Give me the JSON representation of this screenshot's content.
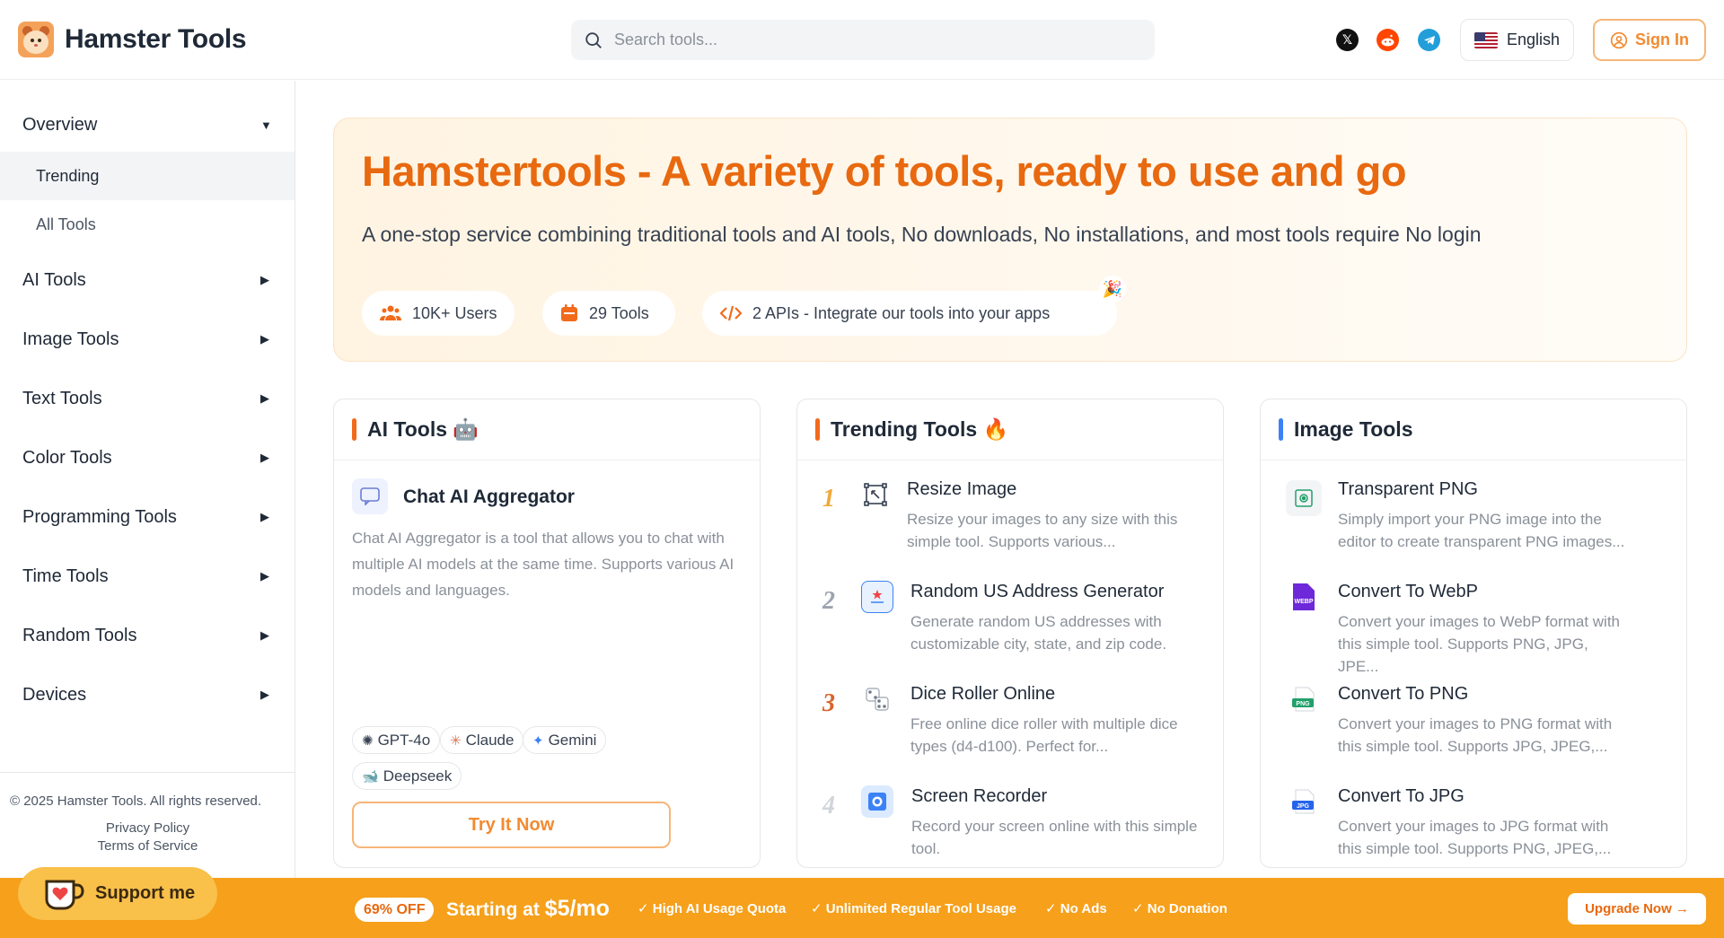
{
  "header": {
    "brand": "Hamster Tools",
    "search_placeholder": "Search tools...",
    "language": "English",
    "signin": "Sign In"
  },
  "sidebar": {
    "overview": "Overview",
    "sub_items": [
      "Trending",
      "All Tools"
    ],
    "items": [
      "AI Tools",
      "Image Tools",
      "Text Tools",
      "Color Tools",
      "Programming Tools",
      "Time Tools",
      "Random Tools",
      "Devices"
    ],
    "copyright": "© 2025 Hamster Tools. All rights reserved.",
    "privacy": "Privacy Policy",
    "terms": "Terms of Service",
    "support": "Support me"
  },
  "hero": {
    "title": "Hamstertools - A variety of tools, ready to use and go",
    "subtitle": "A one-stop service combining traditional tools and AI tools, No downloads, No installations, and most tools require No login",
    "stats": [
      "10K+ Users",
      "29 Tools",
      "2 APIs - Integrate our tools into your apps"
    ]
  },
  "ai_card": {
    "title": "AI Tools 🤖",
    "tool_title": "Chat AI Aggregator",
    "tool_desc": "Chat AI Aggregator is a tool that allows you to chat with multiple AI models at the same time. Supports various AI models and languages.",
    "tags": [
      "GPT-4o",
      "Claude",
      "Gemini",
      "Deepseek"
    ],
    "cta": "Try It Now"
  },
  "trending_card": {
    "title": "Trending Tools 🔥",
    "items": [
      {
        "rank": "1",
        "title": "Resize Image",
        "desc": "Resize your images to any size with this simple tool. Supports various..."
      },
      {
        "rank": "2",
        "title": "Random US Address Generator",
        "desc": "Generate random US addresses with customizable city, state, and zip code."
      },
      {
        "rank": "3",
        "title": "Dice Roller Online",
        "desc": "Free online dice roller with multiple dice types (d4-d100). Perfect for..."
      },
      {
        "rank": "4",
        "title": "Screen Recorder",
        "desc": "Record your screen online with this simple tool."
      }
    ]
  },
  "image_card": {
    "title": "Image Tools",
    "items": [
      {
        "title": "Transparent PNG",
        "desc": "Simply import your PNG image into the editor to create transparent PNG images..."
      },
      {
        "title": "Convert To WebP",
        "desc": "Convert your images to WebP format with this simple tool. Supports PNG, JPG, JPE..."
      },
      {
        "title": "Convert To PNG",
        "desc": "Convert your images to PNG format with this simple tool. Supports JPG, JPEG,..."
      },
      {
        "title": "Convert To JPG",
        "desc": "Convert your images to JPG format with this simple tool. Supports PNG, JPEG,..."
      }
    ]
  },
  "banner": {
    "discount": "69% OFF",
    "starting": "Starting at",
    "price": "$5/mo",
    "features": [
      "High AI Usage Quota",
      "Unlimited Regular Tool Usage",
      "No Ads",
      "No Donation"
    ],
    "upgrade": "Upgrade Now →"
  },
  "colors": {
    "accent": "#e8690f",
    "banner": "#f6a01b",
    "trending_bar": "#f26a1b",
    "image_bar": "#3b82f6"
  }
}
